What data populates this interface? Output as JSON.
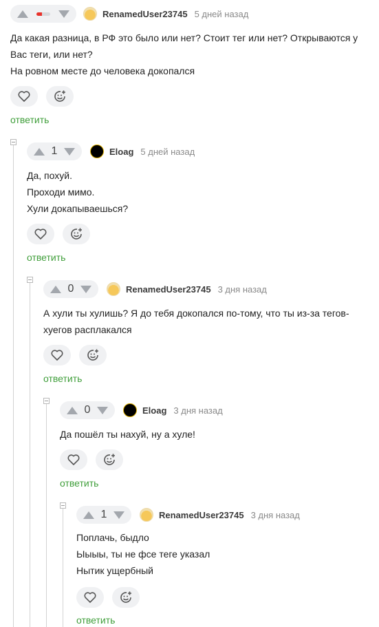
{
  "comments": [
    {
      "author": "RenamedUser23745",
      "time": "5 дней назад",
      "rating": "",
      "rating_negative_fraction": 0.4,
      "lines": [
        "Да какая разница, в РФ это было или нет? Стоит тег или нет? Открываются у",
        "Вас теги, или нет?",
        "На ровном месте до человека докопался"
      ],
      "reply": "ответить",
      "avatar_icon": "pikachu-avatar-icon"
    },
    {
      "author": "Eloag",
      "time": "5 дней назад",
      "rating": "1",
      "lines": [
        "Да, похуй.",
        "Проходи мимо.",
        "Хули докапываешься?"
      ],
      "reply": "ответить",
      "avatar_icon": "black-circle-avatar-icon"
    },
    {
      "author": "RenamedUser23745",
      "time": "3 дня назад",
      "rating": "0",
      "lines": [
        "А хули ты хулишь? Я до тебя докопался по-тому, что ты из-за тегов-",
        "хуегов расплакался"
      ],
      "reply": "ответить",
      "avatar_icon": "pikachu-avatar-icon"
    },
    {
      "author": "Eloag",
      "time": "3 дня назад",
      "rating": "0",
      "lines": [
        "Да пошёл ты нахуй, ну а хуле!"
      ],
      "reply": "ответить",
      "avatar_icon": "black-circle-avatar-icon"
    },
    {
      "author": "RenamedUser23745",
      "time": "3 дня назад",
      "rating": "1",
      "lines": [
        "Поплачь, быдло",
        "Ыыыы, ты не фсе теге указал",
        "Нытик ущербный"
      ],
      "reply": "ответить",
      "avatar_icon": "pikachu-avatar-icon"
    }
  ],
  "icons": {
    "like": "heart-icon",
    "reaction": "add-emoji-icon",
    "upvote": "arrow-up-icon",
    "downvote": "arrow-down-icon",
    "collapse": "collapse-minus-icon"
  },
  "colors": {
    "reply": "#3f9e3a",
    "negative_rating": "#e8322b",
    "pill_bg": "#f0f1f3",
    "muted": "#8a8a8a"
  }
}
